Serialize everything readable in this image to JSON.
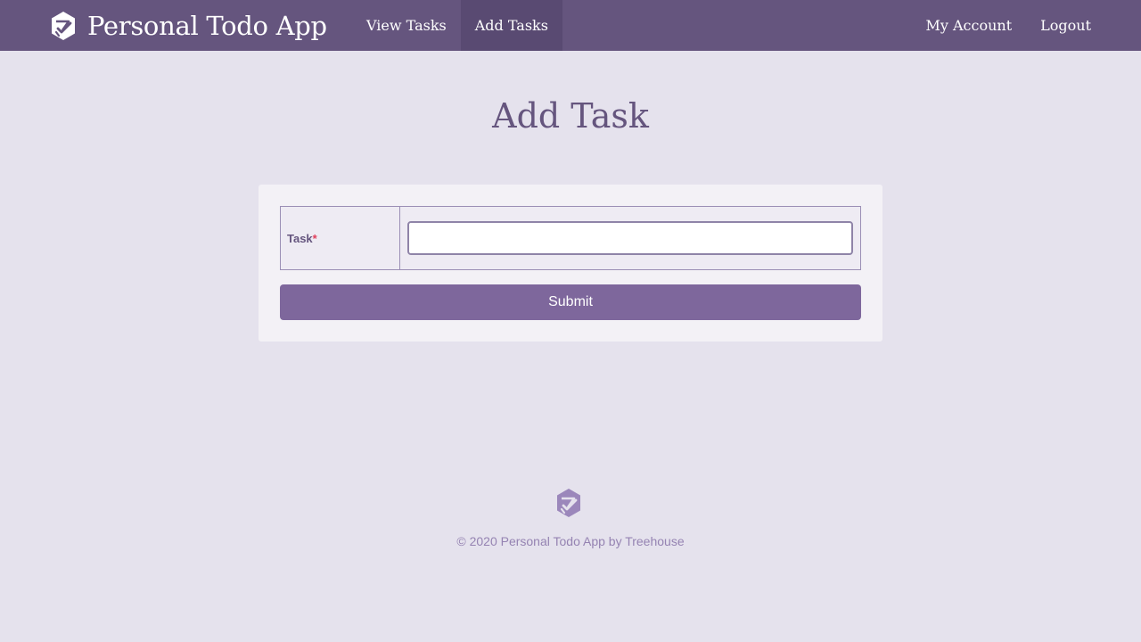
{
  "header": {
    "brand_title": "Personal Todo App",
    "brand_logo_icon": "treehouse-checkmark-logo-icon",
    "nav_left": [
      {
        "label": "View Tasks",
        "active": false
      },
      {
        "label": "Add Tasks",
        "active": true
      }
    ],
    "nav_right": [
      {
        "label": "My Account"
      },
      {
        "label": "Logout"
      }
    ]
  },
  "main": {
    "page_title": "Add Task",
    "form": {
      "task_label": "Task",
      "required_mark": "*",
      "task_value": "",
      "submit_label": "Submit"
    }
  },
  "footer": {
    "logo_icon": "treehouse-checkmark-logo-icon",
    "copyright": "© 2020 Personal Todo App by Treehouse"
  },
  "colors": {
    "navbar": "#65557e",
    "nav_active": "#594a72",
    "background": "#e5e2ed",
    "accent": "#7e679c",
    "required": "#e0405c"
  }
}
